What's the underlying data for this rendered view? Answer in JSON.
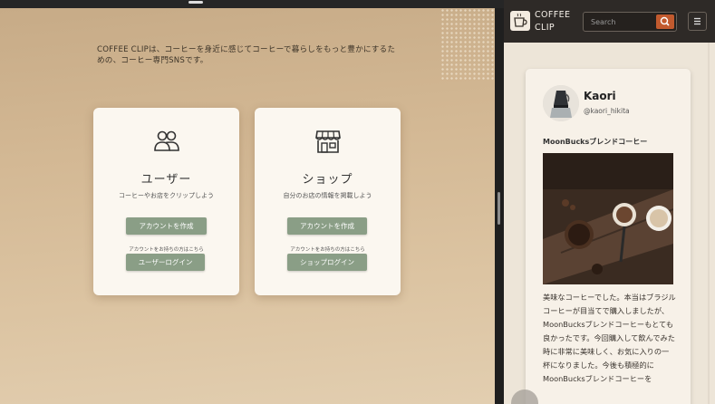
{
  "left": {
    "intro": "COFFEE CLIPは、コーヒーを身近に感じてコーヒーで暮らしをもっと豊かにするための、コーヒー専門SNSです。",
    "user_card": {
      "title": "ユーザー",
      "desc": "コーヒーやお店をクリップしよう",
      "create_label": "アカウントを作成",
      "already_text": "アカウントをお持ちの方はこちら",
      "login_label": "ユーザーログイン"
    },
    "shop_card": {
      "title": "ショップ",
      "desc": "自分のお店の情報を掲載しよう",
      "create_label": "アカウントを作成",
      "already_text": "アカウントをお持ちの方はこちら",
      "login_label": "ショップログイン"
    }
  },
  "right": {
    "header": {
      "logo_text": "COFFEE CLIP",
      "search_placeholder": "Search",
      "menu_icon": "menu-icon"
    },
    "post": {
      "username": "Kaori",
      "handle": "@kaori_hikita",
      "title": "MoonBucksブレンドコーヒー",
      "body": "美味なコーヒーでした。本当はブラジルコーヒーが目当てで購入しましたが、MoonBucksブレンドコーヒーもとても良かったです。今回購入して飲んでみた時に非常に美味しく、お気に入りの一杯になりました。今後も積極的にMoonBucksブレンドコーヒーを"
    }
  },
  "colors": {
    "accent_button": "#8a9e86",
    "header_bg": "#2e2a27",
    "search_button": "#c25a2e"
  }
}
